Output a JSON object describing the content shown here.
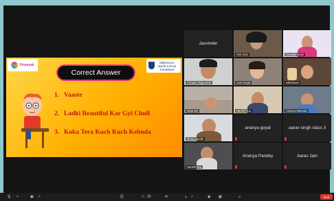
{
  "slide": {
    "banner": "Correct Answer",
    "answers": [
      {
        "num": "1.",
        "text": "Vaaste"
      },
      {
        "num": "2.",
        "text": "Ladki Beautiful Kar Gyi Chull"
      },
      {
        "num": "3.",
        "text": "Koka Tera Kuch Kuch Kehnda"
      }
    ],
    "logo_right_line1": "Millennium",
    "logo_right_line2": "World School",
    "logo_right_line3": "Faridabad",
    "logo_left": "Vinaayak"
  },
  "participants": [
    {
      "name": "Jasvinder",
      "video": false
    },
    {
      "name": "Kriti Soni",
      "video": true
    },
    {
      "name": "Deepika Sethi",
      "video": true
    },
    {
      "name": "Armaan Rajpurohit",
      "video": true
    },
    {
      "name": "Avni Goyal",
      "video": true
    },
    {
      "name": "sakshaam",
      "video": true
    },
    {
      "name": "Divanshi",
      "video": true
    },
    {
      "name": "Harshit Raj",
      "video": true
    },
    {
      "name": "Ananya Mahajan",
      "video": true
    },
    {
      "name": "shrey gandhi",
      "video": true
    },
    {
      "name": "ananya goyal",
      "video": false
    },
    {
      "name": "aarav singh class 3",
      "video": false
    },
    {
      "name": "Harshit Raj",
      "video": true
    },
    {
      "name": "Ananya Pandey",
      "video": false
    },
    {
      "name": "Aarav Jain",
      "video": false
    }
  ],
  "toolbar": {
    "end_label": "End",
    "participant_count": "25"
  },
  "colors": {
    "background": "#8fc7ce",
    "stage": "#141414",
    "answer_text": "#c6141a",
    "banner_border": "#e8327c",
    "end_button": "#e0342a"
  }
}
